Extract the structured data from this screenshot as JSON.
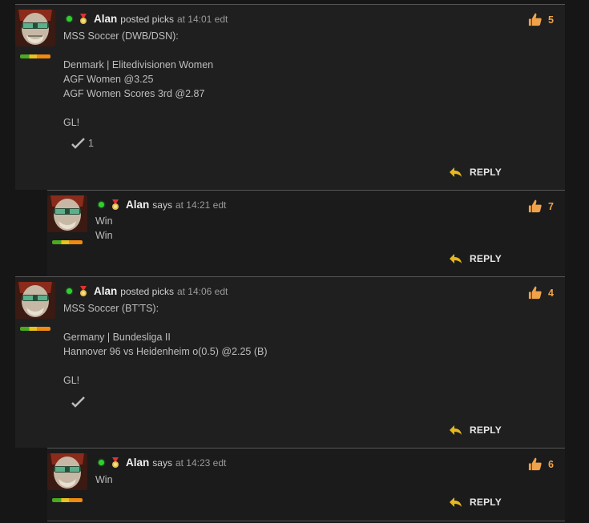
{
  "posts": [
    {
      "author": "Alan",
      "verb": "posted picks",
      "time": "at 14:01 edt",
      "likes": "5",
      "body": "MSS Soccer (DWB/DSN):\n\nDenmark | Elitedivisionen Women\nAGF Women @3.25\nAGF Women Scores 3rd @2.87\n\nGL!",
      "check_count": "1",
      "reply_label": "REPLY",
      "reply": {
        "author": "Alan",
        "verb": "says",
        "time": "at 14:21 edt",
        "likes": "7",
        "body": "Win\nWin",
        "reply_label": "REPLY"
      }
    },
    {
      "author": "Alan",
      "verb": "posted picks",
      "time": "at 14:06 edt",
      "likes": "4",
      "body": "MSS Soccer (BT'TS):\n\nGermany | Bundesliga II\nHannover 96 vs Heidenheim o(0.5) @2.25 (B)\n\nGL!",
      "check_count": "",
      "reply_label": "REPLY",
      "reply": {
        "author": "Alan",
        "verb": "says",
        "time": "at 14:23 edt",
        "likes": "6",
        "body": "Win",
        "reply_label": "REPLY"
      }
    }
  ],
  "colors": {
    "accent": "#f0a24a",
    "online": "#2fcf2f",
    "background": "#161616"
  },
  "icons": {
    "like": "thumbs-up-icon",
    "reply": "reply-arrow-icon",
    "check": "checkmark-icon",
    "medal": "medal-icon"
  }
}
